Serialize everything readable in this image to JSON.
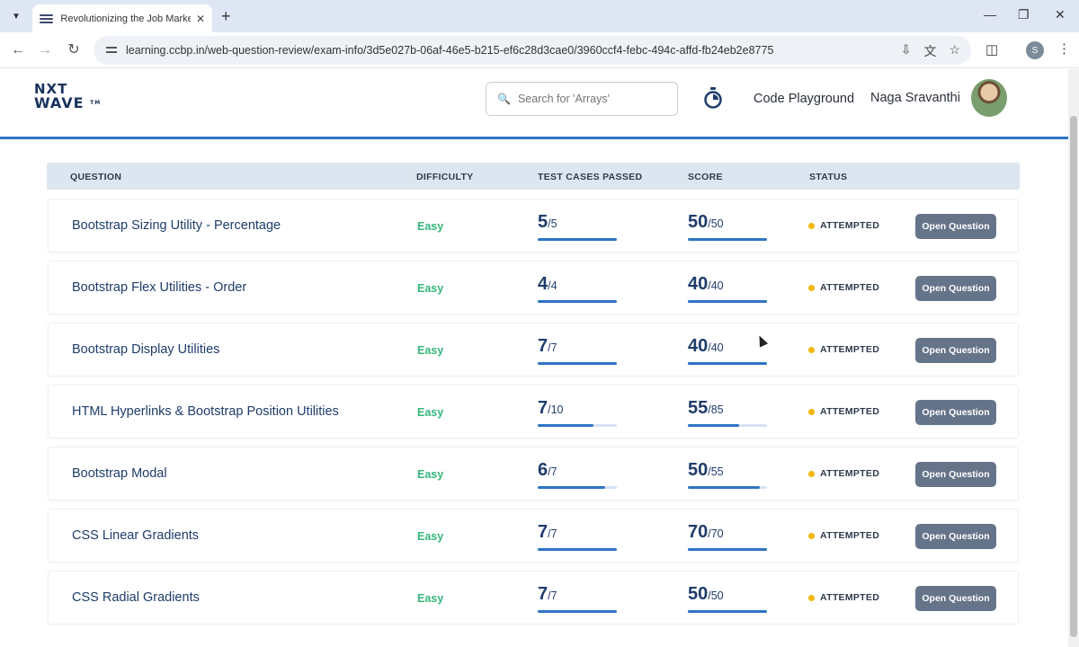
{
  "browser": {
    "tab_title": "Revolutionizing the Job Market | N",
    "url": "learning.ccbp.in/web-question-review/exam-info/3d5e027b-06af-46e5-b215-ef6c28d3cae0/3960ccf4-febc-494c-affd-fb24eb2e8775",
    "profile_initial": "S"
  },
  "header": {
    "logo_line1": "NXT",
    "logo_line2": "WAVE",
    "logo_tm": "TM",
    "search_placeholder": "Search for 'Arrays'",
    "code_playground": "Code Playground",
    "user_name": "Naga Sravanthi"
  },
  "table": {
    "columns": {
      "question": "QUESTION",
      "difficulty": "DIFFICULTY",
      "test_cases": "TEST CASES PASSED",
      "score": "SCORE",
      "status": "STATUS"
    },
    "rows": [
      {
        "title": "Bootstrap Sizing Utility - Percentage",
        "difficulty": "Easy",
        "tc_passed": "5",
        "tc_total": "/5",
        "tc_fraction": 1.0,
        "score": "50",
        "score_total": "/50",
        "score_fraction": 1.0,
        "status": "ATTEMPTED",
        "button": "Open Question"
      },
      {
        "title": "Bootstrap Flex Utilities - Order",
        "difficulty": "Easy",
        "tc_passed": "4",
        "tc_total": "/4",
        "tc_fraction": 1.0,
        "score": "40",
        "score_total": "/40",
        "score_fraction": 1.0,
        "status": "ATTEMPTED",
        "button": "Open Question"
      },
      {
        "title": "Bootstrap Display Utilities",
        "difficulty": "Easy",
        "tc_passed": "7",
        "tc_total": "/7",
        "tc_fraction": 1.0,
        "score": "40",
        "score_total": "/40",
        "score_fraction": 1.0,
        "status": "ATTEMPTED",
        "button": "Open Question"
      },
      {
        "title": "HTML Hyperlinks & Bootstrap Position Utilities",
        "difficulty": "Easy",
        "tc_passed": "7",
        "tc_total": "/10",
        "tc_fraction": 0.7,
        "score": "55",
        "score_total": "/85",
        "score_fraction": 0.647,
        "status": "ATTEMPTED",
        "button": "Open Question"
      },
      {
        "title": "Bootstrap Modal",
        "difficulty": "Easy",
        "tc_passed": "6",
        "tc_total": "/7",
        "tc_fraction": 0.857,
        "score": "50",
        "score_total": "/55",
        "score_fraction": 0.909,
        "status": "ATTEMPTED",
        "button": "Open Question"
      },
      {
        "title": "CSS Linear Gradients",
        "difficulty": "Easy",
        "tc_passed": "7",
        "tc_total": "/7",
        "tc_fraction": 1.0,
        "score": "70",
        "score_total": "/70",
        "score_fraction": 1.0,
        "status": "ATTEMPTED",
        "button": "Open Question"
      },
      {
        "title": "CSS Radial Gradients",
        "difficulty": "Easy",
        "tc_passed": "7",
        "tc_total": "/7",
        "tc_fraction": 1.0,
        "score": "50",
        "score_total": "/50",
        "score_fraction": 1.0,
        "status": "ATTEMPTED",
        "button": "Open Question"
      }
    ]
  },
  "colors": {
    "accent": "#2d74c4",
    "easy": "#35b77c",
    "status_dot": "#f2b705",
    "button": "#66748a"
  }
}
